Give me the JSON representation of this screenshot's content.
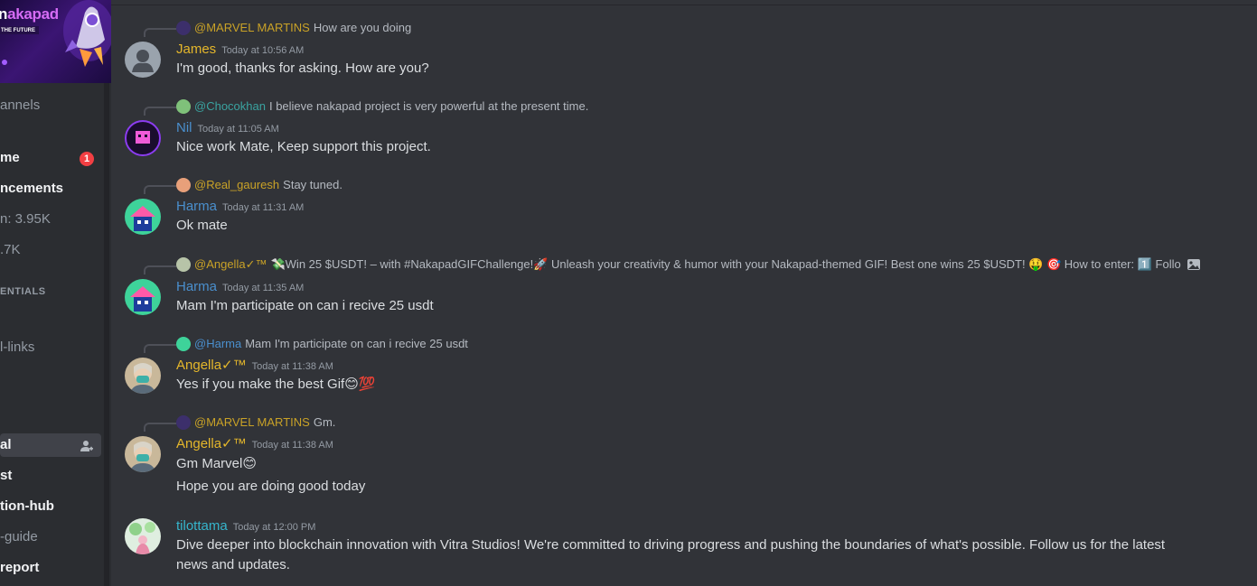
{
  "colors": {
    "bg": "#313338",
    "sidebar": "#2b2d31",
    "gold": "#e5b72b",
    "teal": "#3aa3a0",
    "blue": "#4a8fcd",
    "cyan": "#36b5cc",
    "reply_gold": "#c9a227"
  },
  "sidebar": {
    "banner": {
      "logo_dark": "n",
      "logo_text": "akapad",
      "tagline": "THE FUTURE"
    },
    "items": [
      {
        "label": "annels",
        "style": "muted"
      },
      {
        "label": "me",
        "style": "bold",
        "badge": "1"
      },
      {
        "label": "ncements",
        "style": "bold"
      },
      {
        "label": "n: 3.95K",
        "style": "muted"
      },
      {
        "label": ".7K",
        "style": "muted"
      },
      {
        "label": "ENTIALS",
        "style": "category"
      },
      {
        "label": "l-links",
        "style": "muted"
      },
      {
        "label": "al",
        "style": "selected"
      },
      {
        "label": "st",
        "style": "bold"
      },
      {
        "label": "tion-hub",
        "style": "bold"
      },
      {
        "label": "-guide",
        "style": "muted"
      },
      {
        "label": "report",
        "style": "bold"
      }
    ]
  },
  "messages": [
    {
      "reply": {
        "name": "@MARVEL MARTINS",
        "text": "How are you doing",
        "name_color": "gold",
        "avatar": "marvel-avatar"
      },
      "author": "James",
      "author_color": "gold",
      "time": "Today at 10:56 AM",
      "lines": [
        "I'm good, thanks for asking. How are you?"
      ],
      "avatar": "james-avatar"
    },
    {
      "reply": {
        "name": "@Chocokhan",
        "text": "I believe nakapad project is very powerful at the present time.",
        "name_color": "teal",
        "avatar": "chocokhan-avatar"
      },
      "author": "Nil",
      "author_color": "blue",
      "time": "Today at 11:05 AM",
      "lines": [
        "Nice work Mate, Keep support this project."
      ],
      "avatar": "nil-avatar"
    },
    {
      "reply": {
        "name": "@Real_gauresh",
        "text": "Stay tuned.",
        "name_color": "gold",
        "avatar": "gauresh-avatar"
      },
      "author": "Harma",
      "author_color": "blue",
      "time": "Today at 11:31 AM",
      "lines": [
        "Ok mate"
      ],
      "avatar": "harma-avatar"
    },
    {
      "reply": {
        "name": "@Angella✓™",
        "text": "💸Win 25 $USDT! – with #NakapadGIFChallenge!🚀 Unleash your creativity & humor with your Nakapad-themed GIF! Best one wins 25 $USDT! 🤑 🎯 How to enter: 1️⃣ Follo",
        "name_color": "gold",
        "avatar": "angella-avatar"
      },
      "author": "Harma",
      "author_color": "blue",
      "time": "Today at 11:35 AM",
      "lines": [
        "Mam I'm participate on can i recive 25 usdt"
      ],
      "avatar": "harma-avatar"
    },
    {
      "reply": {
        "name": "@Harma",
        "text": "Mam I'm participate on can i recive 25 usdt",
        "name_color": "blue",
        "avatar": "harma-avatar"
      },
      "author": "Angella✓™",
      "author_color": "gold",
      "time": "Today at 11:38 AM",
      "lines": [
        "Yes if you make the best Gif😊💯"
      ],
      "avatar": "angella-avatar"
    },
    {
      "reply": {
        "name": "@MARVEL MARTINS",
        "text": "Gm.",
        "name_color": "gold",
        "avatar": "marvel-avatar"
      },
      "author": "Angella✓™",
      "author_color": "gold",
      "time": "Today at 11:38 AM",
      "lines": [
        "Gm Marvel😊",
        "Hope you are doing good today"
      ],
      "avatar": "angella-avatar"
    },
    {
      "reply": null,
      "author": "tilottama",
      "author_color": "cyan",
      "time": "Today at 12:00 PM",
      "lines": [
        "Dive deeper into blockchain innovation with Vitra Studios! We're committed to driving progress and pushing the boundaries of what's possible. Follow us for the latest",
        "news and updates."
      ],
      "avatar": "tilottama-avatar"
    }
  ]
}
